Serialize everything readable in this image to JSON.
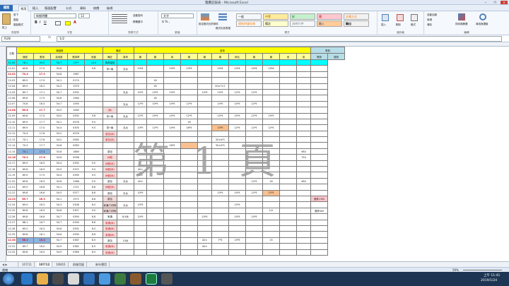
{
  "window": {
    "title": "電費記錄表 - Microsoft Excel",
    "controls": [
      "─",
      "❐",
      "✕"
    ]
  },
  "ribbon_tabs": {
    "file": "檔案",
    "tabs": [
      "常用",
      "插入",
      "版面配置",
      "公式",
      "資料",
      "校閱",
      "檢視"
    ]
  },
  "ribbon": {
    "clipboard": {
      "label": "剪貼簿",
      "paste": "貼上",
      "cut": "剪下",
      "copy": "複製",
      "format": "複製格式"
    },
    "font": {
      "label": "字型",
      "name": "新細明體",
      "size": "12"
    },
    "alignment": {
      "label": "對齊方式",
      "wrap": "自動換列",
      "merge": "跨欄置中"
    },
    "number": {
      "label": "數值",
      "format": "文字"
    },
    "styles": {
      "label": "樣式",
      "cond": "設定格式化的條件",
      "table": "格式化為表格",
      "cells": [
        {
          "t": "一般",
          "bg": "#ffffff"
        },
        {
          "t": "中等",
          "bg": "#ffeb9c"
        },
        {
          "t": "好",
          "bg": "#c6efce"
        },
        {
          "t": "壞",
          "bg": "#ffc7ce"
        },
        {
          "t": "計算方式",
          "bg": "#f2f2f2"
        },
        {
          "t": "連結的儲存格",
          "bg": "#ffffff"
        },
        {
          "t": "備註",
          "bg": "#ffffcc"
        },
        {
          "t": "說明文字",
          "bg": "#ffffff"
        },
        {
          "t": "輸入",
          "bg": "#ffcc99"
        },
        {
          "t": "輸出",
          "bg": "#f2f2f2"
        }
      ]
    },
    "cells": {
      "label": "儲存格",
      "insert": "插入",
      "delete": "刪除",
      "format": "格式"
    },
    "editing": {
      "label": "編輯",
      "autosum": "自動加總",
      "fill": "填滿",
      "clear": "清除",
      "sort": "排序與篩選",
      "find": "尋找與選取"
    }
  },
  "formula_bar": {
    "name_box": "R28",
    "fx": "fx",
    "value": "1/2"
  },
  "watermark": "第 1 頁",
  "table": {
    "top_headers": {
      "date": "日期",
      "reading": "錶讀數",
      "note": "備註",
      "load": "負荷",
      "money": "電費"
    },
    "sub_headers": [
      "錶讀",
      "應用",
      "高用度",
      "應用率",
      "用度",
      "備註",
      "負荷",
      "廠",
      "廠",
      "用",
      "廠",
      "廠",
      "廠",
      "綜合",
      "廠",
      "廠",
      "用",
      "用",
      "電費",
      "退費"
    ],
    "rows": [
      {
        "d": "11.00",
        "r": [
          "78.1",
          "99.5",
          "54.7",
          "15**",
          "10.0"
        ],
        "n": "負荷量回",
        "hl": true
      },
      {
        "d": "12.01",
        "r": [
          "69.8",
          "17.5",
          "54.6",
          "",
          "9.6"
        ],
        "n": "茶+兩",
        "cells": [
          "丸汰",
          "10*4",
          "",
          "10*5",
          "10*5",
          "",
          "10*4",
          "10*4",
          "10*4",
          "10*4"
        ]
      },
      {
        "d": "12.02",
        "r": [
          "70.4",
          "17.9",
          "54.8",
          "1987",
          ""
        ],
        "n": "",
        "red": true
      },
      {
        "d": "12.03",
        "r": [
          "69.5",
          "17.9",
          "54.1",
          "0174",
          ""
        ],
        "n": "",
        "cells": [
          "",
          "",
          "16"
        ]
      },
      {
        "d": "12.04",
        "r": [
          "69.9",
          "16.2",
          "54.2",
          "1579",
          ""
        ],
        "n": "",
        "cells": [
          "",
          "",
          "18",
          "",
          "",
          "",
          "40×7×1"
        ]
      },
      {
        "d": "12.05",
        "r": [
          "69.7",
          "17.1",
          "54.7",
          "0392",
          ""
        ],
        "n": "",
        "cells": [
          "丸汰",
          "10*5",
          "10*5",
          "10*5",
          "",
          "10*5",
          "10*5",
          "12*5",
          "12*5"
        ]
      },
      {
        "d": "12.06",
        "r": [
          "69.8",
          "17.9",
          "54.8",
          "1580",
          ""
        ],
        "n": "",
        "cells": [
          "",
          "",
          "18"
        ]
      },
      {
        "d": "12.07",
        "r": [
          "70.6",
          "16.3",
          "54.7",
          "1595",
          ""
        ],
        "n": "",
        "cells": [
          "丸汰",
          "12*5",
          "10*5",
          "10*5",
          "12*5",
          "",
          "10*5",
          "10*5",
          "12*5"
        ]
      },
      {
        "d": "12.08",
        "r": [
          "69.8",
          "17.7",
          "54.5",
          "1585",
          ""
        ],
        "n": "(休)",
        "red": true,
        "pink": true
      },
      {
        "d": "12.09",
        "r": [
          "69.8",
          "17.4",
          "54.0",
          "0392",
          "9.8"
        ],
        "n": "茶+兩",
        "cells": [
          "丸汰",
          "12*5",
          "10*5",
          "10*5",
          "12*5",
          "",
          "10*5",
          "10*5",
          "12*5",
          "10*5"
        ]
      },
      {
        "d": "12.10",
        "r": [
          "69.9",
          "17.7",
          "54.1",
          "0576",
          "9.5"
        ],
        "n": "",
        "cells": [
          "",
          "",
          "",
          "",
          "16"
        ]
      },
      {
        "d": "12.11",
        "r": [
          "69.9",
          "17.0",
          "54.4",
          "0305",
          "9.5"
        ],
        "n": "茶+兩",
        "cells": [
          "丸汰",
          "10*5",
          "12*5",
          "10*4",
          "16*5",
          "",
          "10*5",
          "12*5",
          "12*5",
          "12*5"
        ],
        "orange": 6
      },
      {
        "d": "12.12",
        "r": [
          "70.4",
          "17.6",
          "54.2",
          "0576",
          ""
        ],
        "n": "新加(休)",
        "pink": true
      },
      {
        "d": "12.13",
        "r": [
          "70.1",
          "17.6",
          "54.2",
          "0582",
          ""
        ],
        "n": "新加(休)",
        "pink": true,
        "cells": [
          "",
          "",
          "",
          "",
          "",
          "",
          "30×4*1"
        ]
      },
      {
        "d": "12.14",
        "r": [
          "70.3",
          "17.7",
          "54.8",
          "0583",
          ""
        ],
        "n": "",
        "cells": [
          "",
          "",
          "",
          "16*5",
          "",
          "",
          "30×4*1"
        ],
        "orange": 4
      },
      {
        "d": "12.15",
        "r": [
          "70.1",
          "17.3",
          "53.8",
          "1689",
          ""
        ],
        "n": "新加",
        "blue": true,
        "cells": [],
        "money": [
          "980"
        ]
      },
      {
        "d": "12.16",
        "r": [
          "70.2",
          "17.6",
          "54.6",
          "0598",
          ""
        ],
        "n": "休假",
        "pink": true,
        "red": true,
        "money": [
          "750"
        ]
      },
      {
        "d": "12.17",
        "r": [
          "69.9",
          "16.9",
          "54.4",
          "0392",
          "9.0"
        ],
        "n": "休假(休)",
        "pink": true
      },
      {
        "d": "12.18",
        "r": [
          "69.8",
          "16.9",
          "54.5",
          "0372",
          "9.0"
        ],
        "n": "休假(休)",
        "pink": true,
        "cells": [
          "",
          "40×"
        ]
      },
      {
        "d": "12.19",
        "r": [
          "69.9",
          "17.5",
          "54.4",
          "0390",
          "9.5"
        ],
        "n": "休假(休)",
        "pink": true,
        "cells": [
          "",
          "40×"
        ]
      },
      {
        "d": "12.20",
        "r": [
          "69.6",
          "16.9",
          "54.6",
          "1588",
          "9.0"
        ],
        "n": "新加",
        "cells": [
          "丸汰",
          "40×",
          "",
          "",
          "",
          "",
          "",
          "",
          "12*5",
          "16"
        ],
        "money": [
          "480"
        ]
      },
      {
        "d": "12.21",
        "r": [
          "69.9",
          "16.6",
          "54.1",
          "1721",
          "8.8"
        ],
        "n": "休假(休)",
        "pink": true
      },
      {
        "d": "12.22",
        "r": [
          "69.8",
          "16.6",
          "54.5",
          "0377",
          "8.8"
        ],
        "n": "新加",
        "cells": [
          "丸汰",
          "10*5",
          "",
          "",
          "",
          "",
          "10*5",
          "10*5",
          "12*5",
          "12*5"
        ],
        "orange": 9
      },
      {
        "d": "12.23",
        "r": [
          "69.7",
          "16.3",
          "54.1",
          "1572",
          "8.8"
        ],
        "n": "新加",
        "red": true,
        "pink": true,
        "money": [
          "",
          "退費1300"
        ]
      },
      {
        "d": "12.24",
        "r": [
          "69.9",
          "16.3",
          "54.3",
          "0308",
          "8.5"
        ],
        "n": "家通/力材財",
        "pink": true,
        "cells": [
          "丸汰",
          "10*5",
          "",
          "",
          "",
          "",
          "",
          "15*5"
        ]
      },
      {
        "d": "12.25",
        "r": [
          "69.6",
          "16.9",
          "54.8",
          "0307",
          "9.0"
        ],
        "n": "家通/力材財",
        "pink": true,
        "cells": [
          "",
          "",
          "",
          "",
          "",
          "",
          "",
          "",
          "",
          "1/2"
        ],
        "money": [
          "",
          "退費300"
        ]
      },
      {
        "d": "12.26",
        "r": [
          "69.8",
          "16.6",
          "54.7",
          "0390",
          "8.8"
        ],
        "n": "家通",
        "cells": [
          "8.6汰",
          "10*5",
          "",
          "",
          "",
          "10*5",
          "",
          "10*5",
          "10*5"
        ]
      },
      {
        "d": "12.27",
        "r": [
          "68.1",
          "16.7",
          "54.7",
          "0390",
          "8.8"
        ],
        "n": "家通(休)",
        "pink": true
      },
      {
        "d": "12.28",
        "r": [
          "69.2",
          "16.3",
          "54.6",
          "0392",
          "8.5"
        ],
        "n": "家通(休)",
        "pink": true
      },
      {
        "d": "12.29",
        "r": [
          "69.8",
          "16.1",
          "54.6",
          "0390",
          "8.8"
        ],
        "n": "家通(休)",
        "pink": true
      },
      {
        "d": "12.30",
        "r": [
          "68.2",
          "15.4",
          "54.7",
          "0387",
          "8.5"
        ],
        "n": "新加",
        "red": true,
        "blue": true,
        "cells": [
          "14汰",
          "",
          "",
          "",
          "",
          "42×",
          "7*5",
          "15*5",
          "",
          "15"
        ]
      },
      {
        "d": "12.31",
        "r": [
          "69.7",
          "16.0",
          "54.9",
          "0382",
          "8.5"
        ],
        "n": "家通(休)",
        "pink": true,
        "cells": [
          "",
          "",
          "",
          "",
          "",
          "40×"
        ]
      },
      {
        "d": "12.32",
        "r": [
          "69.8",
          "16.0",
          "54.9",
          "0389",
          "8.5"
        ],
        "n": "家通(休)",
        "pink": true
      }
    ]
  },
  "sheet_tabs": [
    "107/11",
    "107/12",
    "108/01",
    "前後用量",
    "新年運用"
  ],
  "status": {
    "ready": "就緒",
    "zoom": "59%"
  },
  "taskbar": {
    "time": "上午 11:41",
    "date": "2019/1/24"
  }
}
